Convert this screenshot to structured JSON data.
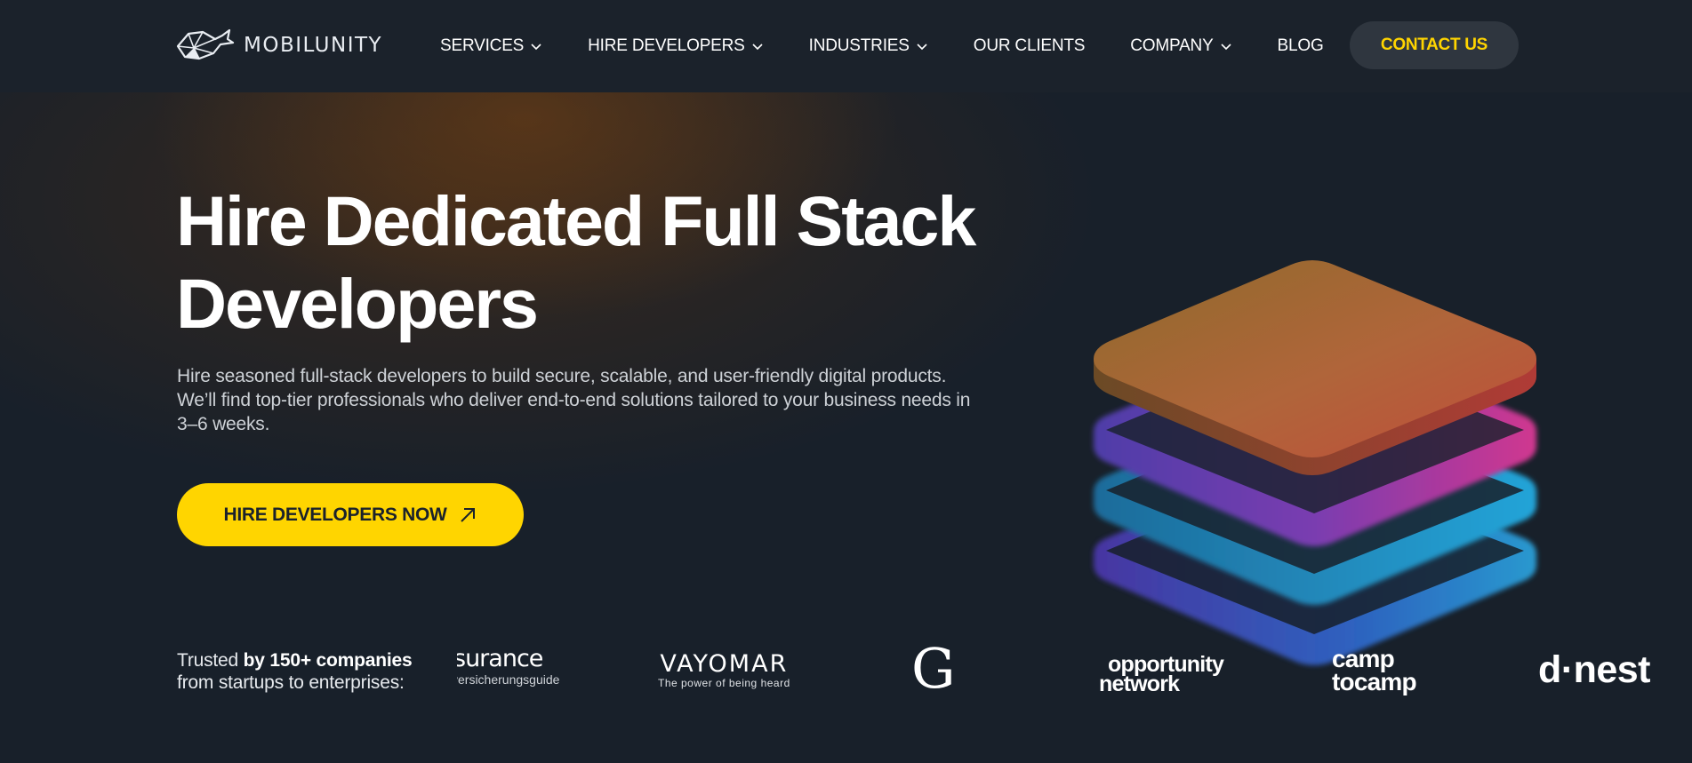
{
  "brand": {
    "name": "MOBILUNITY",
    "logo_icon": "whale-icon"
  },
  "nav": {
    "items": [
      {
        "label": "SERVICES",
        "has_dropdown": true
      },
      {
        "label": "HIRE DEVELOPERS",
        "has_dropdown": true
      },
      {
        "label": "INDUSTRIES",
        "has_dropdown": true
      },
      {
        "label": "OUR CLIENTS",
        "has_dropdown": false
      },
      {
        "label": "COMPANY",
        "has_dropdown": true
      },
      {
        "label": "BLOG",
        "has_dropdown": false
      }
    ],
    "contact_label": "CONTACT US"
  },
  "hero": {
    "title_line1": "Hire Dedicated Full Stack",
    "title_line2": "Developers",
    "subtitle": "Hire seasoned full-stack developers to build secure, scalable, and user-friendly digital products. We’ll find top-tier professionals who deliver end-to-end solutions tailored to your business needs in 3–6 weeks.",
    "cta_label": "HIRE DEVELOPERS NOW",
    "cta_icon": "arrow-up-right-icon"
  },
  "trusted": {
    "prefix": "Trusted ",
    "bold": "by 150+ companies",
    "line2": "from startups to enterprises:"
  },
  "clients": [
    {
      "name_top": "surance",
      "name_bottom": "versicherungsguide"
    },
    {
      "name_top": "VAYOMAR",
      "name_bottom": "The power of being heard"
    },
    {
      "name_top": "G"
    },
    {
      "name_top": "opportunity",
      "name_bottom": "network"
    },
    {
      "name_top": "camp",
      "name_bottom": "tocamp"
    },
    {
      "name_top": "d·nest"
    }
  ],
  "colors": {
    "nav_bg": "#1b222b",
    "page_bg": "#18202a",
    "accent_yellow": "#ffd500",
    "contact_bg": "#2f363f"
  }
}
